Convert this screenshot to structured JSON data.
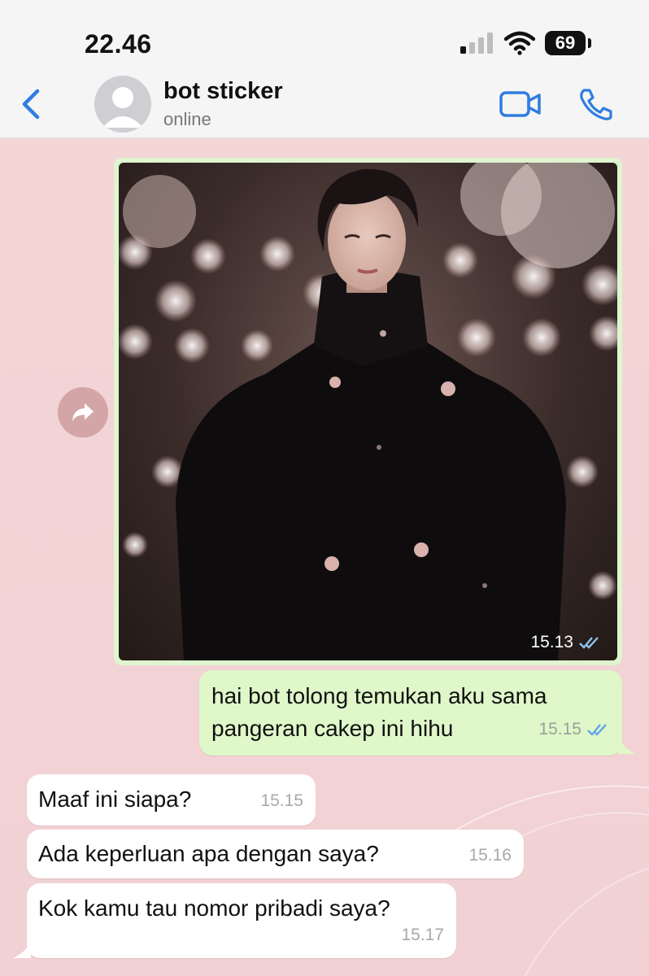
{
  "status_bar": {
    "time": "22.46",
    "battery": "69"
  },
  "header": {
    "contact_name": "bot sticker",
    "contact_status": "online"
  },
  "messages": [
    {
      "type": "image",
      "direction": "out",
      "time": "15.13",
      "ticks": "read"
    },
    {
      "type": "text",
      "direction": "out",
      "lines": [
        "hai bot tolong temukan aku sama",
        "pangeran cakep ini hihu"
      ],
      "time": "15.15",
      "ticks": "read"
    },
    {
      "type": "text",
      "direction": "in",
      "text": "Maaf ini siapa?",
      "time": "15.15"
    },
    {
      "type": "text",
      "direction": "in",
      "text": "Ada keperluan apa dengan saya?",
      "time": "15.16"
    },
    {
      "type": "text",
      "direction": "in",
      "text": "Kok kamu tau nomor pribadi saya?",
      "time": "15.17"
    }
  ],
  "colors": {
    "accent": "#2f7de1",
    "chat_background": "#f3d6d7",
    "outgoing_bubble": "#dff7c9",
    "incoming_bubble": "#ffffff",
    "read_ticks": "#5fa8e8"
  },
  "icons": {
    "back": "chevron-left-icon",
    "video_call": "video-camera-icon",
    "voice_call": "phone-icon",
    "forward": "forward-arrow-icon",
    "avatar": "default-avatar-icon"
  }
}
